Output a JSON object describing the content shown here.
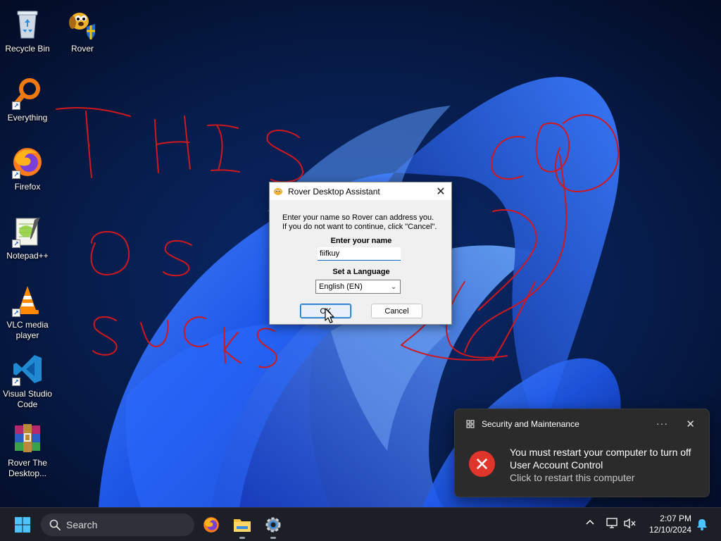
{
  "desktop": {
    "icons": [
      {
        "label": "Recycle Bin"
      },
      {
        "label": "Rover"
      },
      {
        "label": "Everything"
      },
      {
        "label": "Firefox"
      },
      {
        "label": "Notepad++"
      },
      {
        "label": "VLC media player"
      },
      {
        "label": "Visual Studio Code"
      },
      {
        "label": "Rover The Desktop..."
      }
    ]
  },
  "dialog": {
    "title": "Rover Desktop Assistant",
    "message_line1": "Enter your name so Rover can address you.",
    "message_line2": "If you do not want to continue, click \"Cancel\".",
    "name_label": "Enter your name",
    "name_value": "fiifkuy",
    "language_label": "Set a Language",
    "language_value": "English (EN)",
    "ok_label": "OK",
    "cancel_label": "Cancel",
    "close_glyph": "✕"
  },
  "notification": {
    "app": "Security and Maintenance",
    "more_glyph": "···",
    "close_glyph": "✕",
    "line1": "You must restart your computer to turn off",
    "line2": "User Account Control",
    "line3": "Click to restart this computer",
    "error_glyph": "✕",
    "accent": "#e0352b"
  },
  "taskbar": {
    "search_placeholder": "Search",
    "tray_chevron": "^",
    "time": "2:07 PM",
    "date": "12/10/2024"
  },
  "icons": [
    "windows-start-icon",
    "search-icon",
    "firefox-icon",
    "file-explorer-icon",
    "settings-icon",
    "chevron-up-icon",
    "network-icon",
    "volume-muted-icon",
    "notification-bell-icon"
  ]
}
